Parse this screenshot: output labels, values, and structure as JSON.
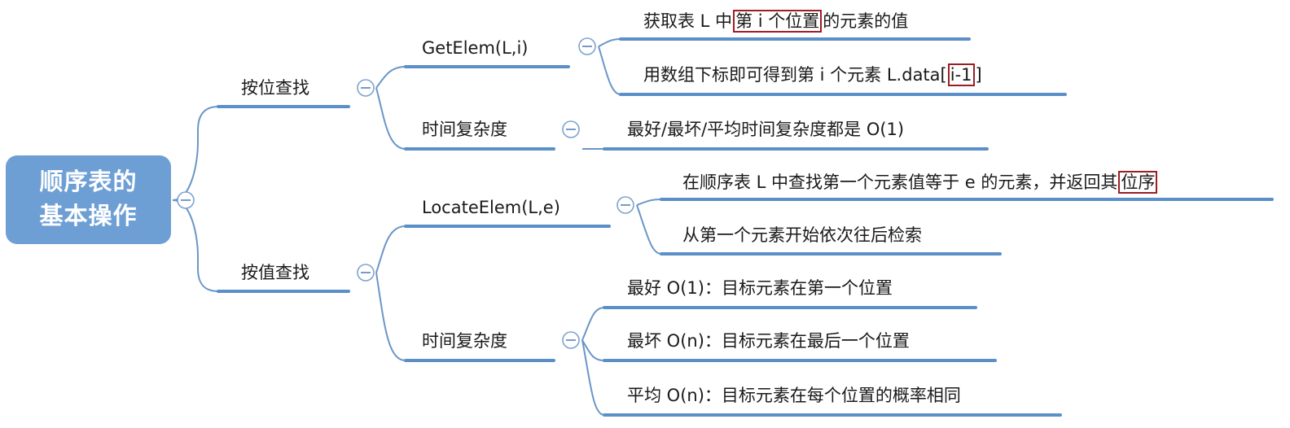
{
  "root": {
    "line1": "顺序表的",
    "line2": "基本操作"
  },
  "branches": {
    "by_position": {
      "label": "按位查找",
      "getelem": {
        "label": "GetElem(L,i)",
        "desc1": {
          "before": "获取表 L 中",
          "highlight": "第 i 个位置",
          "after": "的元素的值"
        },
        "desc2": {
          "before": "用数组下标即可得到第 i 个元素 L.data[",
          "highlight": "i-1",
          "after": "]"
        }
      },
      "complexity": {
        "label": "时间复杂度",
        "text": "最好/最坏/平均时间复杂度都是 O(1)"
      }
    },
    "by_value": {
      "label": "按值查找",
      "locateelem": {
        "label": "LocateElem(L,e)",
        "desc1": {
          "before": "在顺序表 L 中查找第一个元素值等于 e 的元素，并返回其",
          "highlight": "位序"
        },
        "desc2": "从第一个元素开始依次往后检索"
      },
      "complexity": {
        "label": "时间复杂度",
        "best": "最好 O(1)：目标元素在第一个位置",
        "worst": "最坏 O(n)：目标元素在最后一个位置",
        "average": "平均 O(n)：目标元素在每个位置的概率相同"
      }
    }
  },
  "colors": {
    "root_fill": "#6e9fd4",
    "connector": "#5b8fc8",
    "highlight_border": "#9c1e24"
  }
}
